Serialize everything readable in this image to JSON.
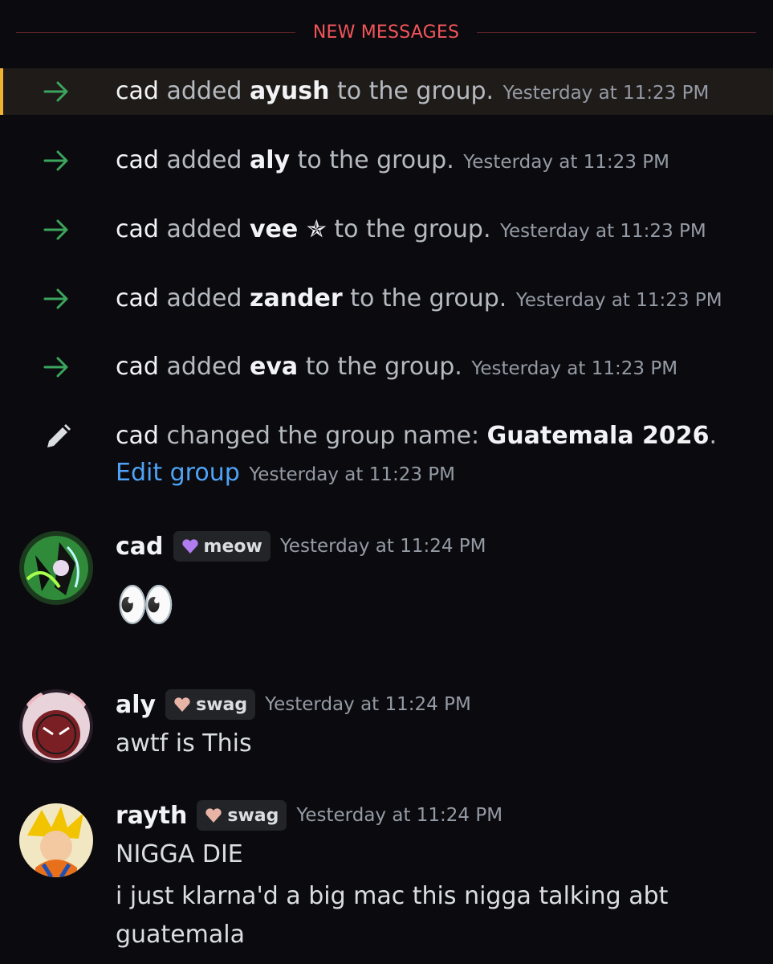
{
  "divider": {
    "label": "NEW MESSAGES"
  },
  "system_messages": [
    {
      "actor": "cad",
      "verb": "added",
      "target": "ayush",
      "suffix": "to the group.",
      "time": "Yesterday at 11:23 PM"
    },
    {
      "actor": "cad",
      "verb": "added",
      "target": "aly",
      "suffix": "to the group.",
      "time": "Yesterday at 11:23 PM"
    },
    {
      "actor": "cad",
      "verb": "added",
      "target": "vee ✯",
      "suffix": "to the group.",
      "time": "Yesterday at 11:23 PM"
    },
    {
      "actor": "cad",
      "verb": "added",
      "target": "zander",
      "suffix": "to the group.",
      "time": "Yesterday at 11:23 PM"
    },
    {
      "actor": "cad",
      "verb": "added",
      "target": "eva",
      "suffix": "to the group.",
      "time": "Yesterday at 11:23 PM"
    }
  ],
  "rename": {
    "actor": "cad",
    "text": "changed the group name:",
    "name": "Guatemala 2026",
    "period": ".",
    "link": "Edit group",
    "time": "Yesterday at 11:23 PM"
  },
  "messages": [
    {
      "author": "cad",
      "tag": "meow",
      "tag_color": "#b07cf0",
      "time": "Yesterday at 11:24 PM",
      "lines": [
        "👀"
      ]
    },
    {
      "author": "aly",
      "tag": "swag",
      "tag_color": "#e8b4a6",
      "time": "Yesterday at 11:24 PM",
      "lines": [
        "awtf is This"
      ]
    },
    {
      "author": "rayth",
      "tag": "swag",
      "tag_color": "#e8b4a6",
      "time": "Yesterday at 11:24 PM",
      "lines": [
        "NIGGA DIE",
        "i just klarna'd a big mac this nigga talking abt guatemala"
      ]
    }
  ],
  "colors": {
    "divider": "#f2555a",
    "arrow": "#3ba55d",
    "link": "#4fa3f7",
    "highlight_bar": "#f0b232"
  }
}
